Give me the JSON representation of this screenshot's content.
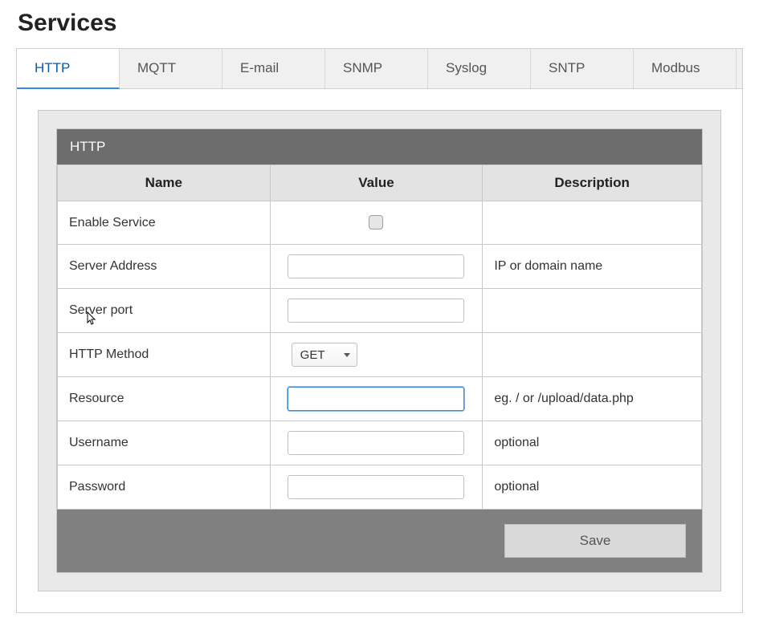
{
  "page": {
    "title": "Services"
  },
  "tabs": [
    {
      "label": "HTTP",
      "active": true
    },
    {
      "label": "MQTT",
      "active": false
    },
    {
      "label": "E-mail",
      "active": false
    },
    {
      "label": "SNMP",
      "active": false
    },
    {
      "label": "Syslog",
      "active": false
    },
    {
      "label": "SNTP",
      "active": false
    },
    {
      "label": "Modbus",
      "active": false
    }
  ],
  "card": {
    "title": "HTTP"
  },
  "columns": {
    "name": "Name",
    "value": "Value",
    "description": "Description"
  },
  "rows": {
    "enable": {
      "name": "Enable Service",
      "checked": false,
      "desc": ""
    },
    "address": {
      "name": "Server Address",
      "value": "",
      "desc": "IP or domain name"
    },
    "port": {
      "name": "Server port",
      "value": "",
      "desc": ""
    },
    "method": {
      "name": "HTTP Method",
      "value": "GET",
      "desc": ""
    },
    "resource": {
      "name": "Resource",
      "value": "",
      "desc": "eg. / or /upload/data.php"
    },
    "username": {
      "name": "Username",
      "value": "",
      "desc": "optional"
    },
    "password": {
      "name": "Password",
      "value": "",
      "desc": "optional"
    }
  },
  "buttons": {
    "save": "Save"
  }
}
